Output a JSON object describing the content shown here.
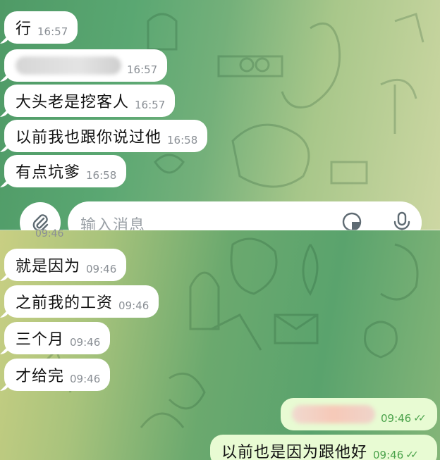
{
  "top": {
    "messages": [
      {
        "text": "行",
        "time": "16:57"
      },
      {
        "text": "",
        "time": "16:57",
        "redacted": true
      },
      {
        "text": "大头老是挖客人",
        "time": "16:57"
      },
      {
        "text": "以前我也跟你说过他",
        "time": "16:58"
      },
      {
        "text": "有点坑爹",
        "time": "16:58"
      }
    ],
    "input": {
      "placeholder": "输入消息"
    }
  },
  "bottom": {
    "partial_time": "09:46",
    "incoming": [
      {
        "text": "就是因为",
        "time": "09:46"
      },
      {
        "text": "之前我的工资",
        "time": "09:46"
      },
      {
        "text": "三个月",
        "time": "09:46"
      },
      {
        "text": "才给完",
        "time": "09:46"
      }
    ],
    "outgoing": [
      {
        "text": "",
        "time": "09:46",
        "redacted": true
      },
      {
        "text": "以前也是因为跟他好",
        "time": "09:46"
      }
    ]
  },
  "icons": {
    "attach": "paperclip-icon",
    "sticker": "sticker-icon",
    "mic": "microphone-icon",
    "read": "double-check-icon"
  }
}
